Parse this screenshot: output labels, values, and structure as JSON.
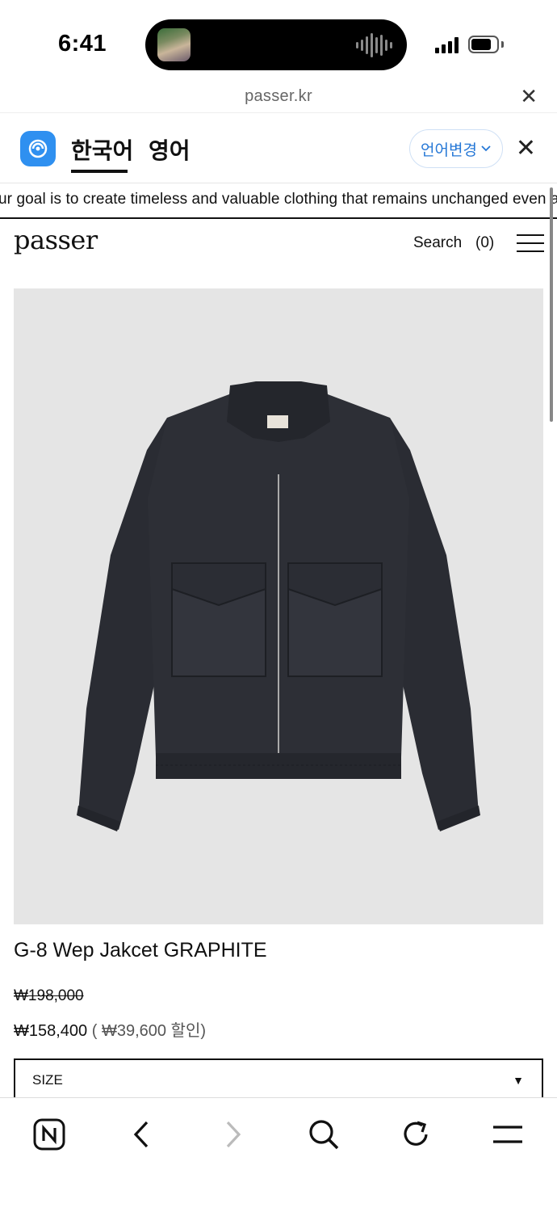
{
  "status_bar": {
    "time": "6:41"
  },
  "browser": {
    "url": "passer.kr"
  },
  "translate_bar": {
    "lang_source": "한국어",
    "lang_target": "영어",
    "change_button": "언어변경"
  },
  "marquee": {
    "text": "ur goal is to create timeless and valuable clothing that remains unchanged even as the years"
  },
  "site_header": {
    "logo": "passer",
    "search": "Search",
    "cart": "(0)"
  },
  "product": {
    "title": "G-8 Wep Jakcet GRAPHITE",
    "original_price": "₩198,000",
    "sale_price": "₩158,400",
    "discount": "( ₩39,600 할인)",
    "size_label": "SIZE"
  },
  "toolbar": {
    "icons": [
      "naver-n-icon",
      "back-icon",
      "forward-icon",
      "search-icon",
      "reload-icon",
      "menu-icon"
    ]
  },
  "colors": {
    "accent_blue": "#2f90f0",
    "link_blue": "#2577d6",
    "image_bg": "#e5e5e5",
    "jacket": "#2a2c33"
  }
}
